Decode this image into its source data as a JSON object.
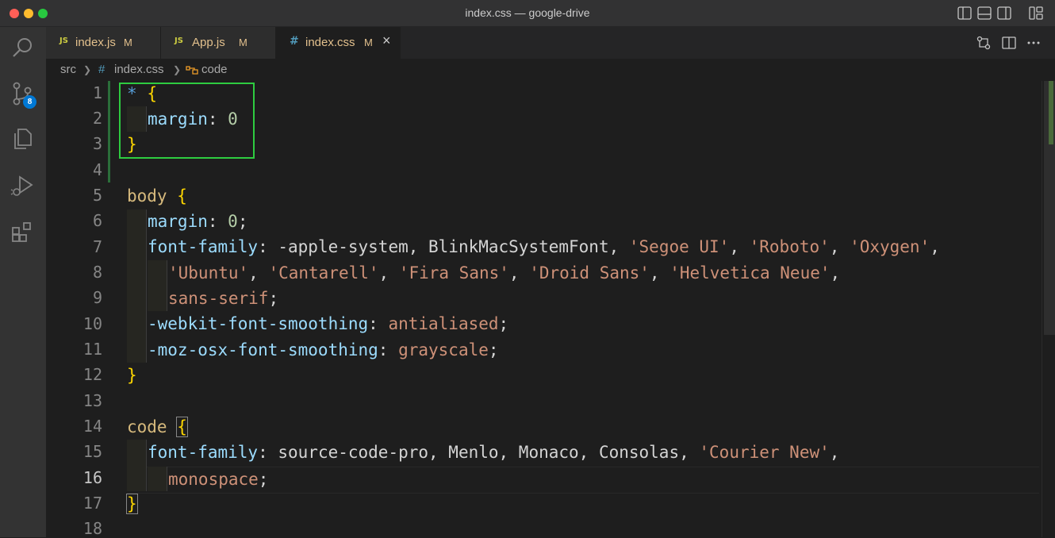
{
  "window": {
    "title": "index.css — google-drive"
  },
  "activity_bar": {
    "items": [
      "search-icon",
      "source-control-icon",
      "explorer-icon",
      "run-debug-icon",
      "extensions-icon"
    ],
    "scm_badge": "8"
  },
  "tabs": [
    {
      "icon": "JS",
      "label": "index.js",
      "status": "M",
      "active": false
    },
    {
      "icon": "JS",
      "label": "App.js",
      "status": "M",
      "active": false
    },
    {
      "icon": "#",
      "label": "index.css",
      "status": "M",
      "active": true,
      "close": "×"
    }
  ],
  "breadcrumb": {
    "folder": "src",
    "file_icon": "#",
    "file": "index.css",
    "symbol": "code"
  },
  "editor": {
    "current_line": 16,
    "lines": [
      {
        "n": "1"
      },
      {
        "n": "2"
      },
      {
        "n": "3"
      },
      {
        "n": "4"
      },
      {
        "n": "5"
      },
      {
        "n": "6"
      },
      {
        "n": "7"
      },
      {
        "n": "8"
      },
      {
        "n": "9"
      },
      {
        "n": "10"
      },
      {
        "n": "11"
      },
      {
        "n": "12"
      },
      {
        "n": "13"
      },
      {
        "n": "14"
      },
      {
        "n": "15"
      },
      {
        "n": "16"
      },
      {
        "n": "17"
      },
      {
        "n": "18"
      }
    ],
    "code": {
      "l1_sel": "*",
      "l1_brace": "{",
      "l2_prop": "margin",
      "l2_colon": ": ",
      "l2_val": "0",
      "l3_brace": "}",
      "l5_sel": "body",
      "l5_brace": "{",
      "l6_prop": "margin",
      "l6_colon": ": ",
      "l6_val": "0",
      "l6_semi": ";",
      "l7_prop": "font-family",
      "l7_colon": ": ",
      "l7_plain": "-apple-system, BlinkMacSystemFont, ",
      "l7_s1": "'Segoe UI'",
      "l7_c1": ", ",
      "l7_s2": "'Roboto'",
      "l7_c2": ", ",
      "l7_s3": "'Oxygen'",
      "l7_c3": ",",
      "l8_s1": "'Ubuntu'",
      "l8_c1": ", ",
      "l8_s2": "'Cantarell'",
      "l8_c2": ", ",
      "l8_s3": "'Fira Sans'",
      "l8_c3": ", ",
      "l8_s4": "'Droid Sans'",
      "l8_c4": ", ",
      "l8_s5": "'Helvetica Neue'",
      "l8_c5": ",",
      "l9_val": "sans-serif",
      "l9_semi": ";",
      "l10_prop": "-webkit-font-smoothing",
      "l10_colon": ": ",
      "l10_val": "antialiased",
      "l10_semi": ";",
      "l11_prop": "-moz-osx-font-smoothing",
      "l11_colon": ": ",
      "l11_val": "grayscale",
      "l11_semi": ";",
      "l12_brace": "}",
      "l14_sel": "code",
      "l14_brace": "{",
      "l15_prop": "font-family",
      "l15_colon": ": ",
      "l15_plain": "source-code-pro, Menlo, Monaco, Consolas, ",
      "l15_s1": "'Courier New'",
      "l15_c1": ",",
      "l16_val": "monospace",
      "l16_semi": ";",
      "l17_brace": "}"
    }
  },
  "colors": {
    "modified": "#e2c08d",
    "selector": "#d7ba7d",
    "property": "#9cdcfe",
    "string": "#ce9178",
    "number": "#b5cea8",
    "brace": "#ffd700",
    "highlight_box": "#2ecc40"
  }
}
